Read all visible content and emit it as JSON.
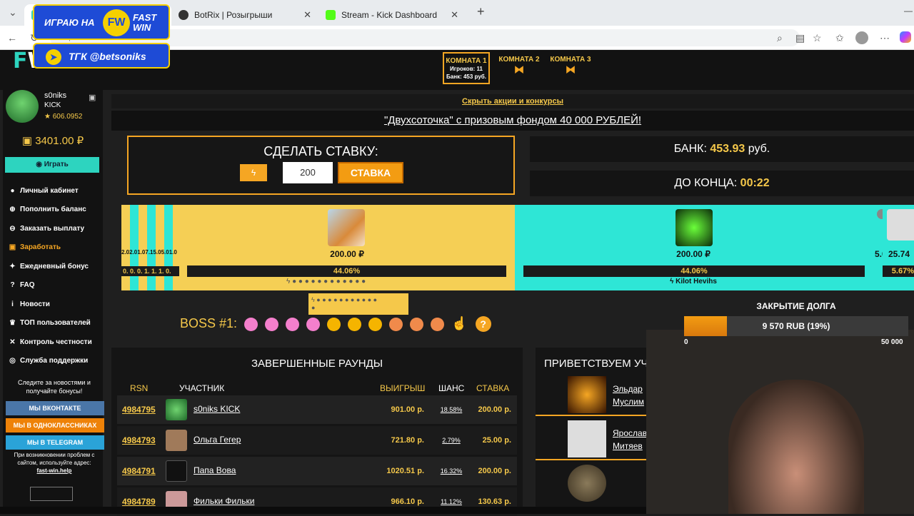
{
  "browser": {
    "tabs": [
      {
        "label": ""
      },
      {
        "label": "BotRix | Розыгрыши"
      },
      {
        "label": "Stream - Kick Dashboard"
      }
    ],
    "url": "https://fast-win.ru/?room=1"
  },
  "overlay": {
    "playing_on": "ИГРАЮ НА",
    "brand": "FAST WIN",
    "telegram": "ТГК @betsoniks"
  },
  "rooms": [
    {
      "title": "КОМНАТА 1",
      "players": "Игроков: 11",
      "bank": "Банк: 453 руб."
    },
    {
      "title": "КОМНАТА 2"
    },
    {
      "title": "КОМНАТА 3"
    }
  ],
  "sidebar": {
    "logo": "WIN",
    "username": "s0niks",
    "platform": "KICK",
    "rating": "★ 606.0952",
    "balance": "3401.00 ₽",
    "play_label": "Играть",
    "menu": [
      {
        "label": "Личный кабинет",
        "icon": "user-icon"
      },
      {
        "label": "Пополнить баланс",
        "icon": "plus-icon"
      },
      {
        "label": "Заказать выплату",
        "icon": "withdraw-icon"
      },
      {
        "label": "Заработать",
        "icon": "money-icon"
      },
      {
        "label": "Ежедневный бонус",
        "icon": "gift-icon"
      },
      {
        "label": "FAQ",
        "icon": "question-icon"
      },
      {
        "label": "Новости",
        "icon": "info-icon"
      },
      {
        "label": "ТОП пользователей",
        "icon": "trophy-icon"
      },
      {
        "label": "Контроль честности",
        "icon": "shuffle-icon"
      },
      {
        "label": "Служба поддержки",
        "icon": "support-icon"
      }
    ],
    "follow_text": "Следите за новостями и получайте бонусы!",
    "socials": [
      {
        "label": "МЫ ВКОНТАКТЕ",
        "color": "#4a76a8"
      },
      {
        "label": "МЫ В ОДНОКЛАССНИКАХ",
        "color": "#ee8208"
      },
      {
        "label": "МЫ В TELEGRAM",
        "color": "#2aa3d8"
      }
    ],
    "help_text": "При возникновении проблем с сайтом, используйте адрес:",
    "help_link": "fast-win.help"
  },
  "promo": {
    "hide_link": "Скрыть акции и конкурсы",
    "headline": "\"Двухсоточка\" с призовым фондом 40 000 РУБЛЕЙ!"
  },
  "stake": {
    "title": "СДЕЛАТЬ СТАВКУ:",
    "input_value": "200",
    "button": "СТАВКА"
  },
  "bank": {
    "label": "БАНК:",
    "value": "453.93",
    "unit": "руб."
  },
  "timer": {
    "label": "ДО КОНЦА:",
    "value": "00:22"
  },
  "wheel": {
    "small_values": [
      "2.0",
      "2.0",
      "1.0",
      "7.1",
      "5.0",
      "5.0",
      "1.0"
    ],
    "small_pcts": [
      "0.",
      "0.",
      "0.",
      "1.",
      "1.",
      "1.",
      "0."
    ],
    "players": [
      {
        "amount": "200.00 ₽",
        "chance": "44.06%",
        "name": ""
      },
      {
        "amount": "200.00 ₽",
        "chance": "44.06%",
        "name": "Kilot Hevihs"
      },
      {
        "amount": "25.74",
        "chance": "5.67%",
        "name": ""
      }
    ],
    "partial_left": "5.0"
  },
  "boss": {
    "label": "BOSS #1:",
    "help": "?"
  },
  "debt": {
    "title": "ЗАКРЫТИЕ ДОЛГА",
    "text": "9 570 RUB (19%)",
    "progress": 0.19,
    "min": "0",
    "max": "50 000"
  },
  "rounds": {
    "title": "ЗАВЕРШЕННЫЕ РАУНДЫ",
    "headers": {
      "rsn": "RSN",
      "player": "УЧАСТНИК",
      "win": "ВЫИГРЫШ",
      "chance": "ШАНС",
      "bet": "СТАВКА"
    },
    "rows": [
      {
        "id": "4984795",
        "name": "s0niks KICK",
        "win": "901.00 р.",
        "chance": "18.58%",
        "bet": "200.00 р."
      },
      {
        "id": "4984793",
        "name": "Ольга Гегер",
        "win": "721.80 р.",
        "chance": "2.79%",
        "bet": "25.00 р."
      },
      {
        "id": "4984791",
        "name": "Папа Вова",
        "win": "1020.51 р.",
        "chance": "16.32%",
        "bet": "200.00 р."
      },
      {
        "id": "4984789",
        "name": "Фильки Фильки",
        "win": "966.10 р.",
        "chance": "11.12%",
        "bet": "130.63 р."
      }
    ]
  },
  "welcome": {
    "title": "ПРИВЕТСТВУЕМ УЧ",
    "users": [
      {
        "first": "Эльдар",
        "last": "Муслим"
      },
      {
        "first": "Ярослав",
        "last": "Митяев"
      },
      {
        "first": "",
        "last": ""
      }
    ]
  }
}
